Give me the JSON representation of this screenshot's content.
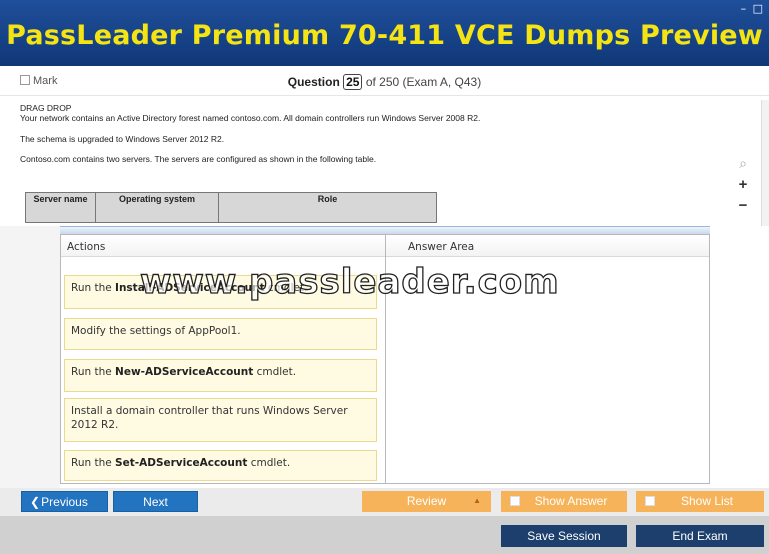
{
  "window": {
    "title": "PassLeader Premium 70-411 VCE Dumps Preview",
    "controls": [
      "–",
      "□"
    ]
  },
  "header": {
    "mark_label": "Mark",
    "question_label": "Question",
    "question_number": "25",
    "question_of": "of 250 (Exam A, Q43)"
  },
  "question": {
    "type": "DRAG DROP",
    "line1": "Your network contains an Active Directory forest named contoso.com. All domain controllers run Windows Server 2008 R2.",
    "line2": "The schema is upgraded to Windows Server 2012 R2.",
    "line3": "Contoso.com contains two servers. The servers are configured as shown in the following table."
  },
  "zoom": {
    "magnifier_icon": "⌕",
    "zoom_in": "+",
    "zoom_out": "−"
  },
  "server_table": {
    "headers": [
      "Server name",
      "Operating system",
      "Role"
    ]
  },
  "drag_drop": {
    "actions_header": "Actions",
    "answer_header": "Answer Area",
    "items": [
      {
        "prefix": "Run the ",
        "bold": "Install-ADServiceAccount",
        "suffix": " cmdlet."
      },
      {
        "prefix": "Modify the settings of AppPool1.",
        "bold": "",
        "suffix": ""
      },
      {
        "prefix": "Run the ",
        "bold": "New-ADServiceAccount",
        "suffix": " cmdlet."
      },
      {
        "prefix": "Install a domain controller that runs Windows Server 2012 R2.",
        "bold": "",
        "suffix": ""
      },
      {
        "prefix": "Run the ",
        "bold": "Set-ADServiceAccount",
        "suffix": " cmdlet."
      }
    ]
  },
  "watermark": "www.passleader.com",
  "nav": {
    "previous": "Previous",
    "next": "Next",
    "review": "Review",
    "show_answer": "Show Answer",
    "show_list": "Show List"
  },
  "bottom": {
    "save_session": "Save Session",
    "end_exam": "End Exam"
  },
  "colors": {
    "title_bg": "#1a4a92",
    "title_text": "#f5e414",
    "nav_blue": "#2273c0",
    "nav_orange": "#f6b35a",
    "bottom_btn": "#1d3f6d"
  }
}
